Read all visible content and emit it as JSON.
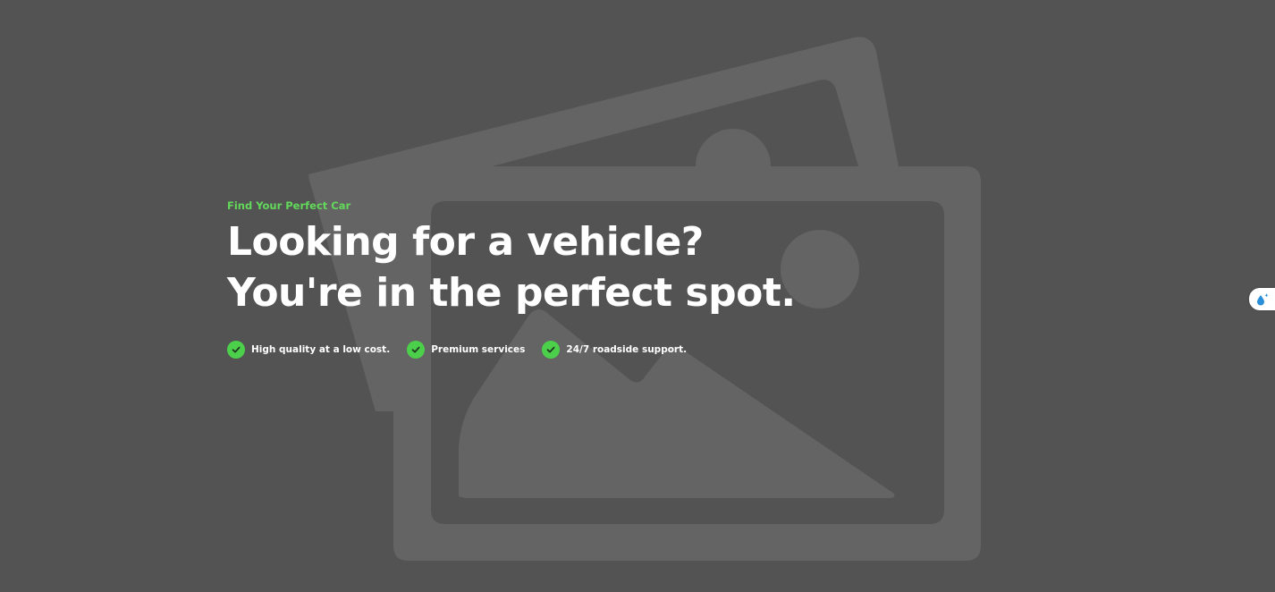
{
  "hero": {
    "eyebrow": "Find Your Perfect Car",
    "headline_line1": "Looking for a vehicle?",
    "headline_line2": "You're in the perfect spot.",
    "features": [
      {
        "label": "High quality at a low cost.",
        "icon": "check-icon"
      },
      {
        "label": "Premium services",
        "icon": "check-icon"
      },
      {
        "label": "24/7 roadside support.",
        "icon": "check-icon"
      }
    ]
  },
  "side_widget": {
    "icon": "water-drop-sparkle-icon"
  },
  "background": {
    "icon": "image-placeholder-icon"
  },
  "colors": {
    "background": "#535353",
    "placeholder_shape": "#666666",
    "accent_green": "#62d95a",
    "check_green": "#4ccf4a",
    "text": "#ffffff"
  }
}
